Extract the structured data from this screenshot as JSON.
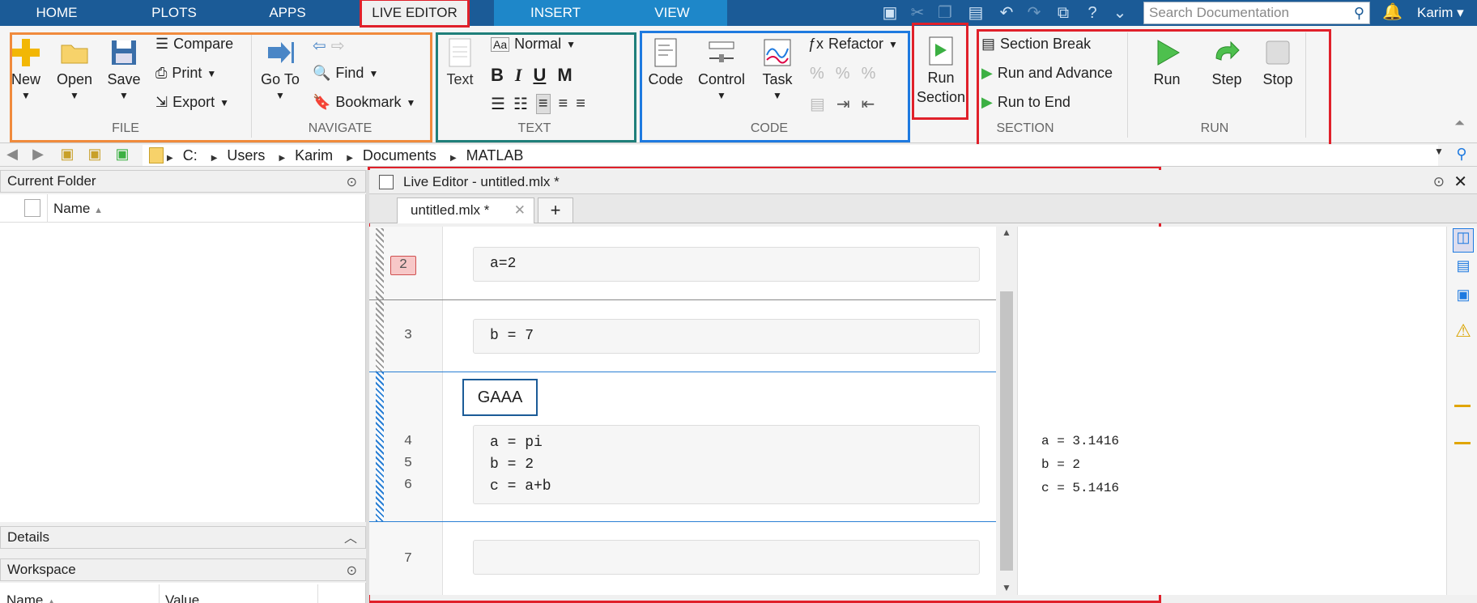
{
  "tabs": {
    "home": "HOME",
    "plots": "PLOTS",
    "apps": "APPS",
    "live_editor": "LIVE EDITOR",
    "insert": "INSERT",
    "view": "VIEW"
  },
  "search": {
    "placeholder": "Search Documentation"
  },
  "user": {
    "name": "Karim"
  },
  "ribbon": {
    "file": {
      "group": "FILE",
      "new": "New",
      "open": "Open",
      "save": "Save",
      "compare": "Compare",
      "print": "Print",
      "export": "Export"
    },
    "navigate": {
      "group": "NAVIGATE",
      "goto": "Go To",
      "find": "Find",
      "bookmark": "Bookmark"
    },
    "text": {
      "group": "TEXT",
      "text_btn": "Text",
      "style": "Normal",
      "bold": "B",
      "italic": "I",
      "underline": "U",
      "mono": "M"
    },
    "code": {
      "group": "CODE",
      "code_btn": "Code",
      "control": "Control",
      "task": "Task",
      "refactor": "Refactor"
    },
    "run_section": {
      "line1": "Run",
      "line2": "Section"
    },
    "section": {
      "group": "SECTION",
      "section_break": "Section Break",
      "run_and_advance": "Run and Advance",
      "run_to_end": "Run to End"
    },
    "run": {
      "group": "RUN",
      "run": "Run",
      "step": "Step",
      "stop": "Stop"
    }
  },
  "path": [
    "C:",
    "Users",
    "Karim",
    "Documents",
    "MATLAB"
  ],
  "current_folder": {
    "title": "Current Folder",
    "name_col": "Name"
  },
  "details": {
    "title": "Details"
  },
  "workspace": {
    "title": "Workspace",
    "name_col": "Name",
    "value_col": "Value"
  },
  "editor": {
    "title": "Live Editor - untitled.mlx *",
    "tab": "untitled.mlx *",
    "heading": "GAAA",
    "lines": {
      "l2": {
        "num": "2",
        "code": "a=2"
      },
      "l3": {
        "num": "3",
        "code": "b = 7"
      },
      "l4": {
        "num": "4",
        "code": "a = pi"
      },
      "l5": {
        "num": "5",
        "code": "b = 2"
      },
      "l6": {
        "num": "6",
        "code": "c = a+b"
      },
      "l7": {
        "num": "7",
        "code": ""
      }
    },
    "output": [
      "a = 3.1416",
      "b = 2",
      "c = 5.1416"
    ]
  },
  "colors": {
    "tabbar": "#1b5b97",
    "highlight_red": "#e0202a",
    "file_orange": "#f08a3c",
    "text_teal": "#1f7f7a",
    "code_blue": "#1e7ae0",
    "section_divider": "#2a7fd4"
  }
}
